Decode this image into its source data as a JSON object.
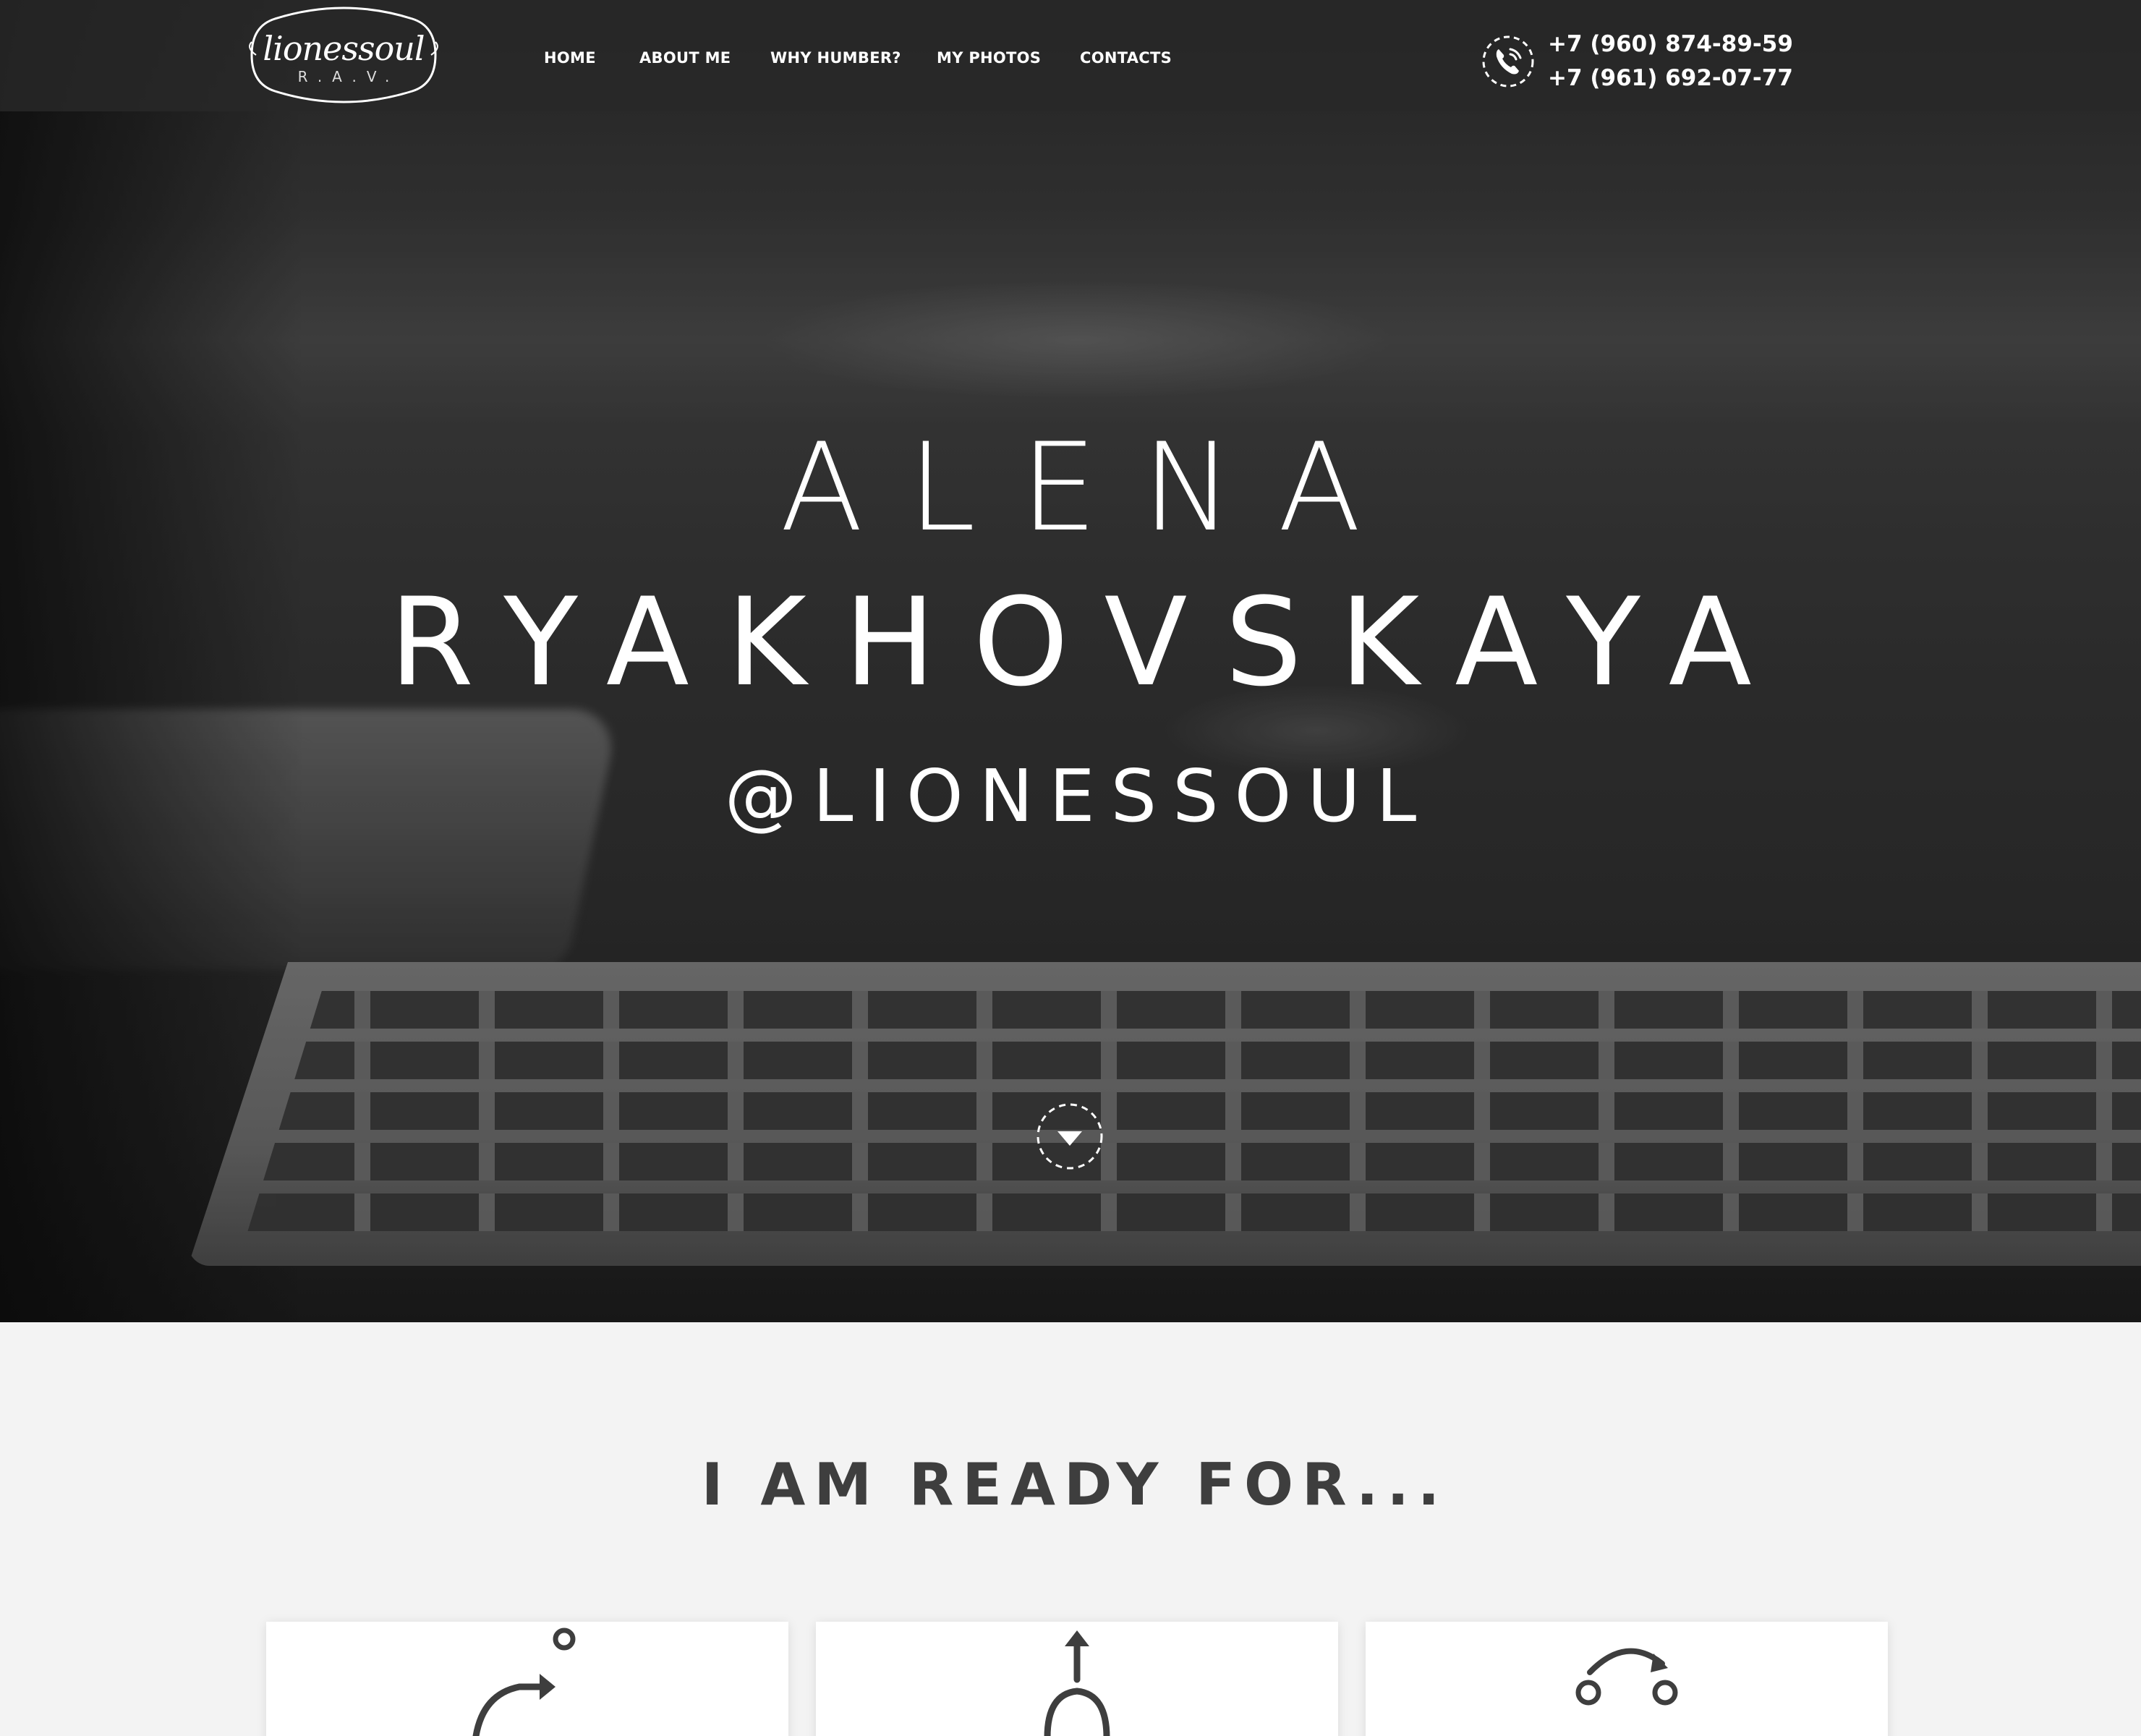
{
  "site": {
    "logo_text": "lionessoul",
    "logo_sub": "R.A.V."
  },
  "nav": {
    "items": [
      {
        "label": "HOME"
      },
      {
        "label": "ABOUT ME"
      },
      {
        "label": "WHY HUMBER?"
      },
      {
        "label": "MY PHOTOS"
      },
      {
        "label": "CONTACTS"
      }
    ]
  },
  "contact": {
    "phone_icon": "phone-icon",
    "phones": [
      "+7 (960) 874-89-59",
      "+7 (961) 692-07-77"
    ]
  },
  "hero": {
    "first_name": "ALENA",
    "last_name": "RYAKHOVSKAYA",
    "handle": "@LIONESSOUL",
    "scroll_icon": "chevron-down-icon"
  },
  "ready": {
    "title": "I AM READY FOR...",
    "cards": [
      {
        "icon": "relocation-icon"
      },
      {
        "icon": "growth-icon"
      },
      {
        "icon": "teamwork-icon"
      }
    ]
  },
  "colors": {
    "header_bg": "#282828",
    "section_bg": "#f3f3f3",
    "title_text": "#3e3e3e",
    "card_bg": "#ffffff"
  }
}
